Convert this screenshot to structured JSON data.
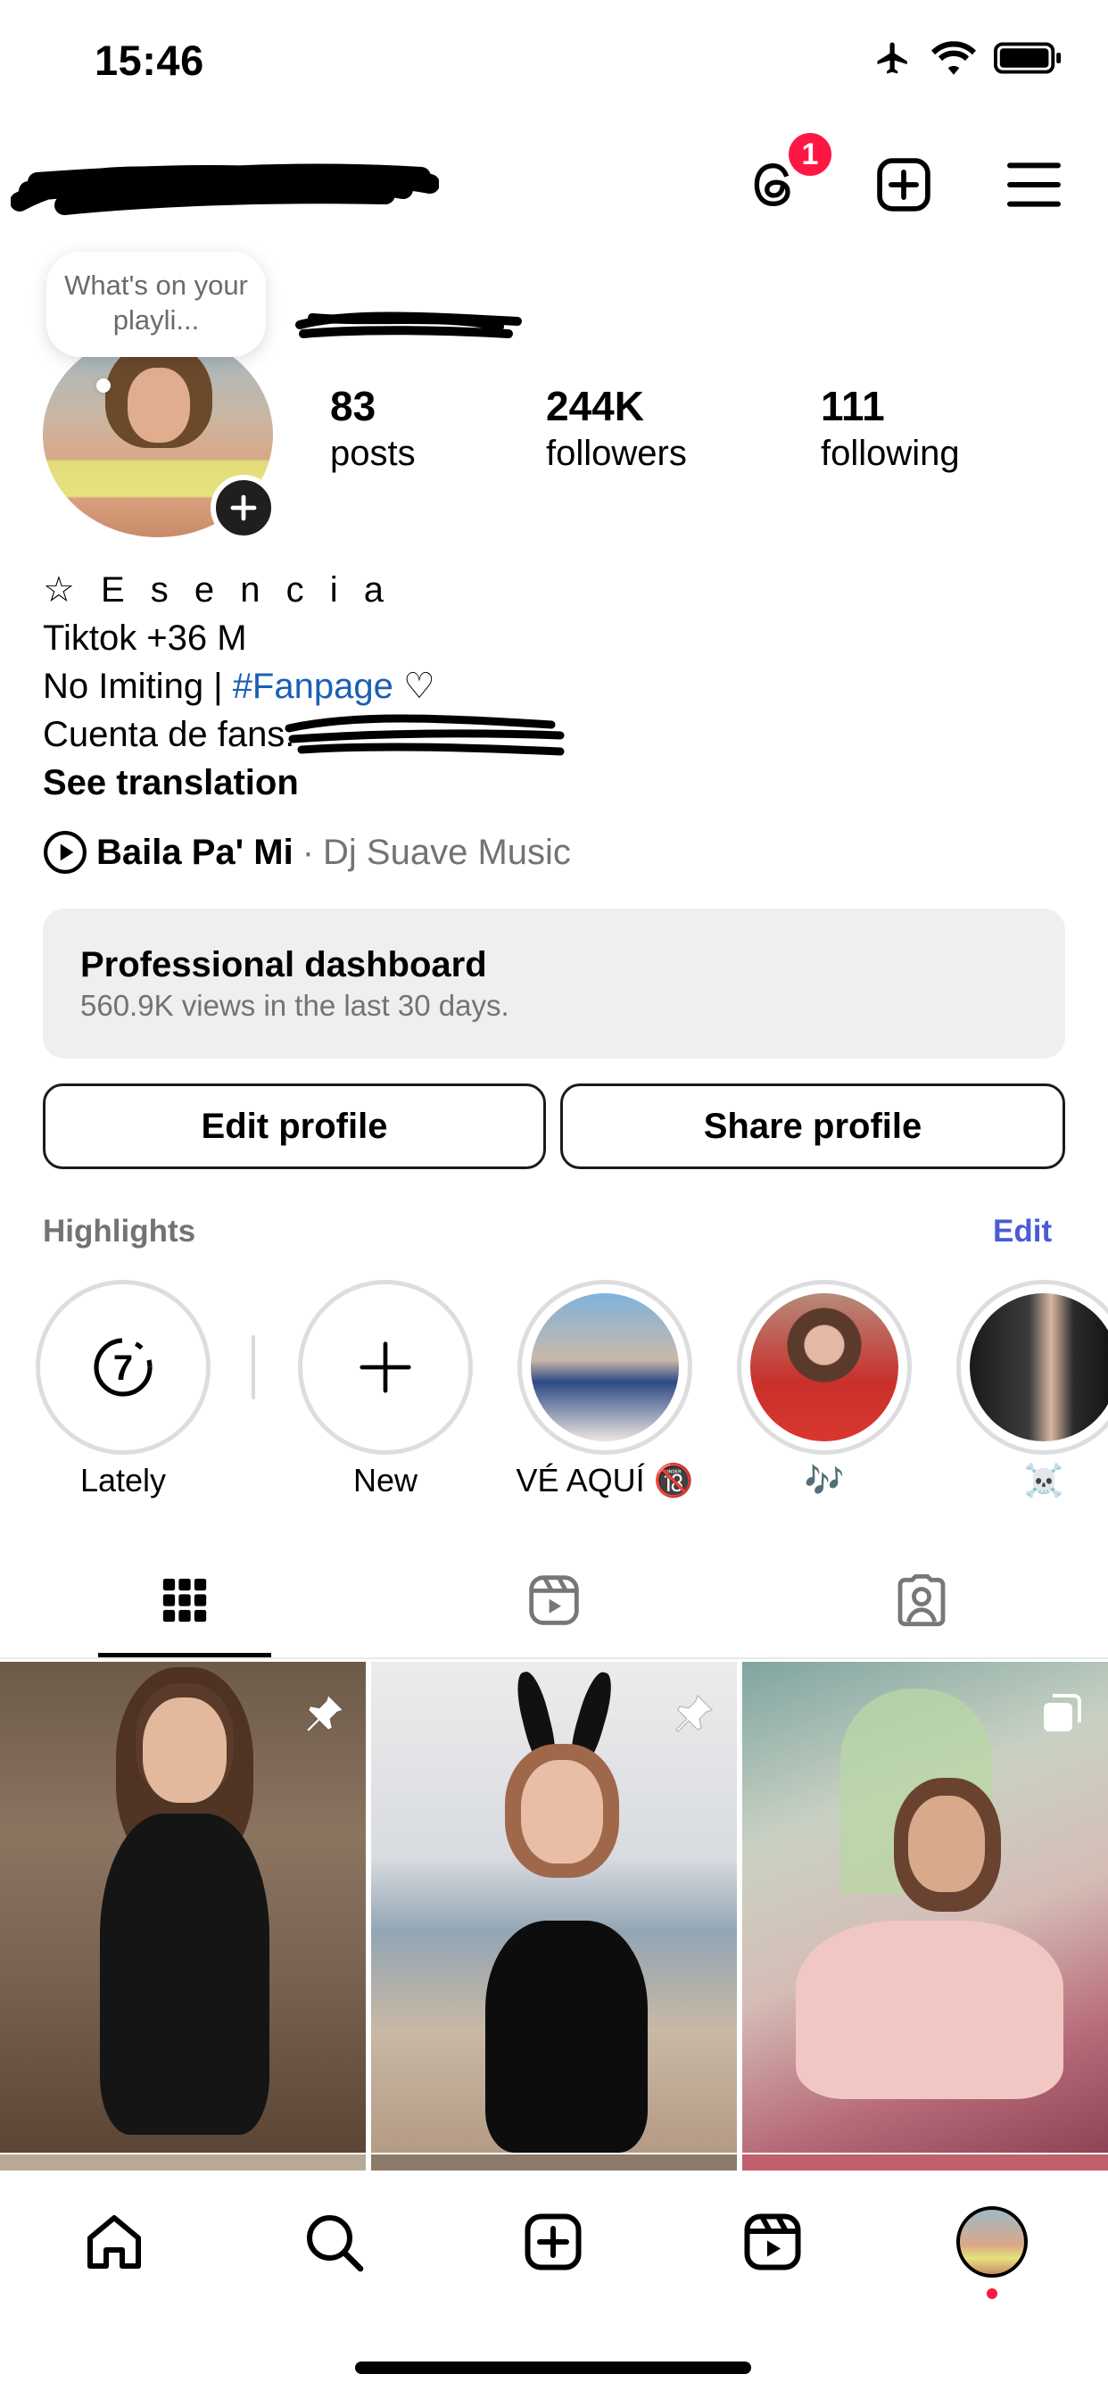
{
  "status_bar": {
    "time": "15:46"
  },
  "header": {
    "notification_count": "1"
  },
  "profile": {
    "note": "What's on your playli...",
    "stats": [
      {
        "value": "83",
        "label": "posts"
      },
      {
        "value": "244K",
        "label": "followers"
      },
      {
        "value": "111",
        "label": "following"
      }
    ],
    "bio": {
      "line1": "☆ E s e n c i a",
      "line2": "Tiktok +36 M",
      "line3_prefix": "No Imiting | ",
      "line3_link": "#Fanpage",
      "line3_suffix": " ♡",
      "line4_prefix": "Cuenta de fans:",
      "see_translation": "See translation"
    },
    "music": {
      "title": "Baila Pa' Mi",
      "separator": "·",
      "artist": "Dj Suave Music"
    }
  },
  "dashboard": {
    "title": "Professional dashboard",
    "subtitle": "560.9K views in the last 30 days."
  },
  "buttons": {
    "edit_profile": "Edit profile",
    "share_profile": "Share profile"
  },
  "highlights": {
    "title": "Highlights",
    "edit": "Edit",
    "items": [
      {
        "label": "Lately",
        "badge": "7"
      },
      {
        "label": "New"
      },
      {
        "label": "VÉ AQUÍ 🔞"
      },
      {
        "label": "🎶"
      },
      {
        "label": "☠️"
      }
    ]
  },
  "colors": {
    "badge": "#ff1744",
    "link": "#1a5fb4",
    "edit": "#4a5bd6",
    "muted": "#737373"
  }
}
